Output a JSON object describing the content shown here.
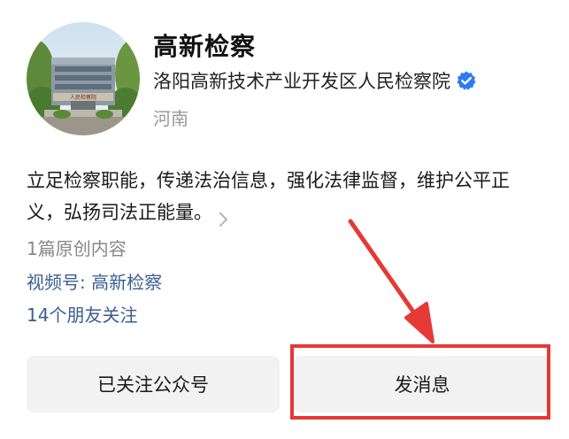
{
  "profile": {
    "name": "高新检察",
    "organization": "洛阳高新技术产业开发区人民检察院",
    "region": "河南",
    "avatar_sign_text": "人民检察院"
  },
  "description": {
    "line1": "立足检察职能，传递法治信息，强化法律监督，维护公平正",
    "line2": "义，弘扬司法正能量。"
  },
  "stats": {
    "original_count": "1篇原创内容",
    "channels": "视频号: 高新检察",
    "friends_follow": "14个朋友关注"
  },
  "actions": {
    "followed_label": "已关注公众号",
    "message_label": "发消息"
  },
  "colors": {
    "verified": "#2f7bf5",
    "link": "#3b5d8f",
    "annotation": "#e53935"
  },
  "icons": {
    "verified": "verified-badge-icon",
    "more": "chevron-right-icon"
  }
}
